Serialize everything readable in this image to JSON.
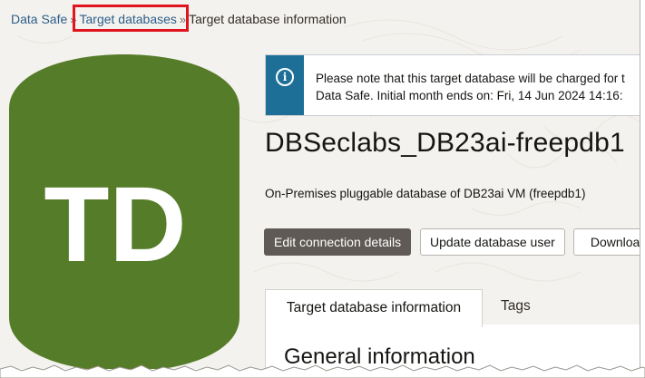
{
  "breadcrumb": {
    "items": [
      "Data Safe",
      "Target databases",
      "Target database information"
    ],
    "separator": "»"
  },
  "target_icon": {
    "initials": "TD",
    "color": "#557c29"
  },
  "notice": {
    "line1": "Please note that this target database will be charged for t",
    "line2": "Data Safe. Initial month ends on: Fri, 14 Jun 2024 14:16:",
    "icon": "info-icon",
    "accent_color": "#1e6f98"
  },
  "title": "DBSeclabs_DB23ai-freepdb1",
  "description": "On-Premises pluggable database of DB23ai VM (freepdb1)",
  "actions": {
    "edit_connection": "Edit connection details",
    "update_user": "Update database user",
    "download": "Download"
  },
  "tabs": [
    {
      "label": "Target database information",
      "active": true
    },
    {
      "label": "Tags",
      "active": false
    }
  ],
  "section_heading": "General information",
  "highlight_color": "#e0141e"
}
